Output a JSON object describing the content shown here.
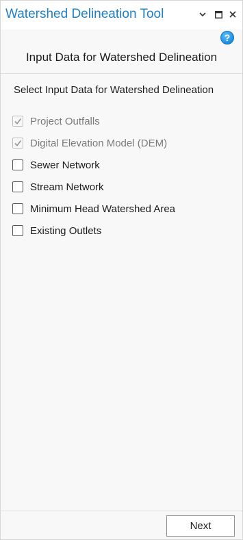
{
  "window": {
    "title": "Watershed Delineation Tool",
    "controls": [
      {
        "icon": "chevron-down-icon"
      },
      {
        "icon": "maximize-icon"
      },
      {
        "icon": "close-icon"
      }
    ],
    "help_label": "?"
  },
  "page": {
    "heading": "Input Data for Watershed Delineation",
    "section_label": "Select Input Data for Watershed Delineation"
  },
  "options": [
    {
      "label": "Project Outfalls",
      "checked": true,
      "disabled": true
    },
    {
      "label": "Digital Elevation Model (DEM)",
      "checked": true,
      "disabled": true
    },
    {
      "label": "Sewer Network",
      "checked": false,
      "disabled": false
    },
    {
      "label": "Stream Network",
      "checked": false,
      "disabled": false
    },
    {
      "label": "Minimum Head Watershed Area",
      "checked": false,
      "disabled": false
    },
    {
      "label": "Existing Outlets",
      "checked": false,
      "disabled": false
    }
  ],
  "footer": {
    "next_label": "Next"
  },
  "colors": {
    "title": "#1f7fc7",
    "help_badge": "#1a8ce0",
    "checkmark_disabled": "#9a9a9a"
  }
}
